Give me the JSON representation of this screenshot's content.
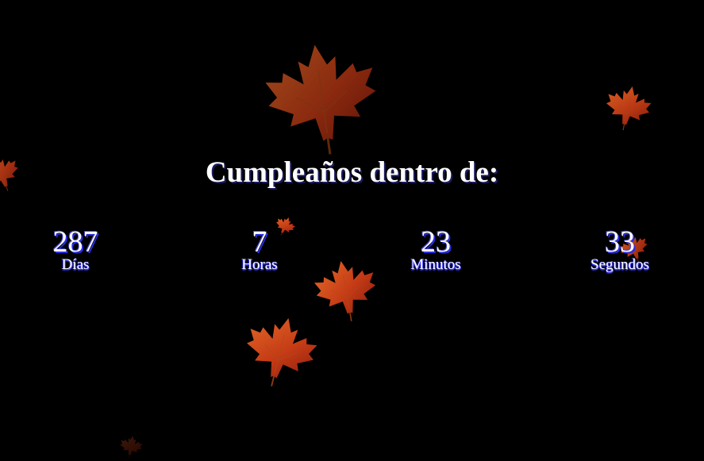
{
  "heading": "Cumpleaños dentro de:",
  "countdown": [
    {
      "value": "287",
      "label": "Días"
    },
    {
      "value": "7",
      "label": "Horas"
    },
    {
      "value": "23",
      "label": "Minutos"
    },
    {
      "value": "33",
      "label": "Segundos"
    }
  ],
  "colors": {
    "background": "#000000",
    "text": "#ffffff",
    "text_shadow": "#2a2ee0",
    "leaf_light": "#e0702a",
    "leaf_dark": "#a8260f"
  },
  "decorations": {
    "icon": "maple-leaf-icon"
  }
}
